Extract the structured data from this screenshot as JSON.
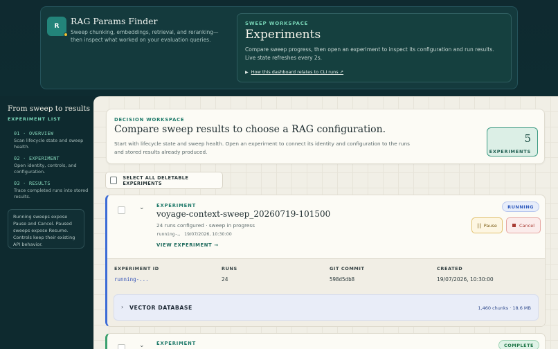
{
  "app": {
    "logo_letter": "R",
    "title": "RAG Params Finder",
    "description": "Sweep chunking, embeddings, retrieval, and reranking—then inspect what worked on your evaluation queries."
  },
  "workspace": {
    "kicker": "SWEEP WORKSPACE",
    "title": "Experiments",
    "description": "Compare sweep progress, then open an experiment to inspect its configuration and run results. Live state refreshes every 2s.",
    "link_label": "How this dashboard relates to CLI runs ↗"
  },
  "sidebar": {
    "title": "From sweep to results",
    "kicker": "EXPERIMENT LIST",
    "items": [
      {
        "num": "01 · OVERVIEW",
        "text": "Scan lifecycle state and sweep health."
      },
      {
        "num": "02 · EXPERIMENT",
        "text": "Open identity, controls, and configuration."
      },
      {
        "num": "03 · RESULTS",
        "text": "Trace completed runs into stored results."
      }
    ],
    "note": "Running sweeps expose Pause and Cancel. Paused sweeps expose Resume. Controls keep their existing API behavior."
  },
  "decision": {
    "kicker": "DECISION WORKSPACE",
    "title": "Compare sweep results to choose a RAG configuration.",
    "description": "Start with lifecycle state and sweep health. Open an experiment to connect its identity and configuration to the runs and stored results already produced.",
    "count": "5",
    "count_label": "EXPERIMENTS"
  },
  "select_all_label": "SELECT ALL DELETABLE EXPERIMENTS",
  "experiments": [
    {
      "kicker": "EXPERIMENT",
      "name": "voyage-context-sweep_20260719-101500",
      "subtitle": "24 runs configured · sweep in progress",
      "id_short": "running-…",
      "timestamp": "19/07/2026, 10:30:00",
      "view_label": "VIEW EXPERIMENT →",
      "status": "RUNNING",
      "pause_label": "Pause",
      "cancel_label": "Cancel",
      "details": {
        "id_label": "EXPERIMENT ID",
        "id_value": "running-...",
        "runs_label": "RUNS",
        "runs_value": "24",
        "commit_label": "GIT COMMIT",
        "commit_value": "598d5db8",
        "created_label": "CREATED",
        "created_value": "19/07/2026, 10:30:00"
      },
      "vector_db": {
        "label": "VECTOR DATABASE",
        "stats": "1,460 chunks · 18.6 MB"
      }
    },
    {
      "kicker": "EXPERIMENT",
      "status": "COMPLETE"
    }
  ],
  "colors": {
    "header_bg": "#0e2a2f",
    "accent_teal": "#1f7a6a",
    "running_border": "#3b6bd6",
    "complete_border": "#3aa06e"
  }
}
